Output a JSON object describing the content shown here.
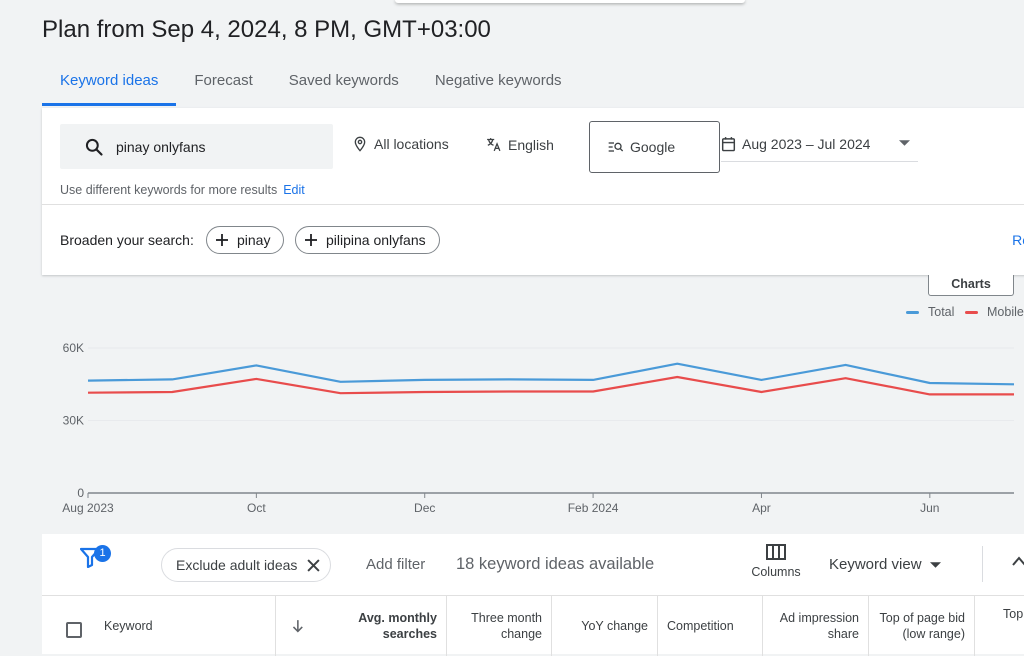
{
  "page": {
    "title": "Plan from Sep 4, 2024, 8 PM, GMT+03:00"
  },
  "tabs": [
    {
      "label": "Keyword ideas",
      "active": true
    },
    {
      "label": "Forecast",
      "active": false
    },
    {
      "label": "Saved keywords",
      "active": false
    },
    {
      "label": "Negative keywords",
      "active": false
    }
  ],
  "search": {
    "value": "pinay onlyfans",
    "icon": "search-icon"
  },
  "options": {
    "locations": "All locations",
    "language": "English",
    "network": "Google",
    "date_range": "Aug 2023 – Jul 2024"
  },
  "hint": {
    "text": "Use different keywords for more results",
    "edit_label": "Edit"
  },
  "broaden": {
    "label": "Broaden your search:",
    "chips": [
      "pinay",
      "pilipina onlyfans"
    ],
    "refine_label": "Re"
  },
  "chart_controls": {
    "charts_label": "Charts"
  },
  "chart_data": {
    "type": "line",
    "x": [
      "Aug 2023",
      "Sep",
      "Oct",
      "Nov",
      "Dec",
      "Jan",
      "Feb 2024",
      "Mar",
      "Apr",
      "May",
      "Jun",
      "Jul"
    ],
    "tick_labels": [
      "Aug 2023",
      "Oct",
      "Dec",
      "Feb 2024",
      "Apr",
      "Jun"
    ],
    "tick_indices": [
      0,
      2,
      4,
      6,
      8,
      10
    ],
    "series": [
      {
        "name": "Total",
        "color": "#4a9ad8",
        "values": [
          46500,
          47000,
          52800,
          46000,
          46800,
          47000,
          46800,
          53500,
          46800,
          53000,
          45500,
          45000
        ]
      },
      {
        "name": "Mobile",
        "color": "#e84c4c",
        "values": [
          41500,
          41800,
          47200,
          41300,
          41800,
          42000,
          42000,
          48000,
          41800,
          47500,
          40800,
          40800
        ]
      }
    ],
    "ylim": [
      0,
      60000
    ],
    "y_ticks": [
      {
        "value": 0,
        "label": "0"
      },
      {
        "value": 30000,
        "label": "30K"
      },
      {
        "value": 60000,
        "label": "60K"
      }
    ],
    "legend_position": "top-right",
    "grid": true
  },
  "filterbar": {
    "filter_badge": "1",
    "exclude_chip": "Exclude adult ideas",
    "add_filter": "Add filter",
    "ideas_count": "18 keyword ideas available",
    "columns_label": "Columns",
    "view_label": "Keyword view"
  },
  "table": {
    "headers": {
      "keyword": "Keyword",
      "avg_monthly": "Avg. monthly searches",
      "three_month": "Three month change",
      "yoy": "YoY change",
      "competition": "Competition",
      "ad_impression": "Ad impression share",
      "top_bid_low": "Top of page bid (low range)",
      "top_bid_high": "Top"
    }
  }
}
